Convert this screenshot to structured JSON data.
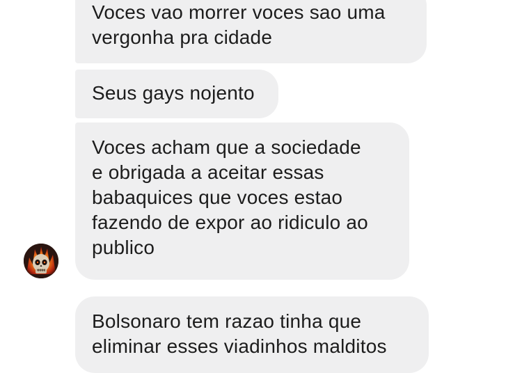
{
  "conversation": {
    "messages": [
      {
        "text": "Voces vao morrer voces sao uma\nvergonha pra cidade"
      },
      {
        "text": "Seus gays nojento"
      },
      {
        "text": "Voces acham que a sociedade\ne obrigada a aceitar essas\nbabaquices que voces estao\nfazendo de expor ao ridiculo ao\npublico"
      },
      {
        "text": "Bolsonaro tem razao tinha que\neliminar esses viadinhos malditos"
      }
    ],
    "sender_avatar": {
      "icon": "flaming-skull-icon"
    }
  },
  "colors": {
    "bubble_bg": "#efeff0",
    "text": "#1c1c1c",
    "background": "#ffffff"
  }
}
